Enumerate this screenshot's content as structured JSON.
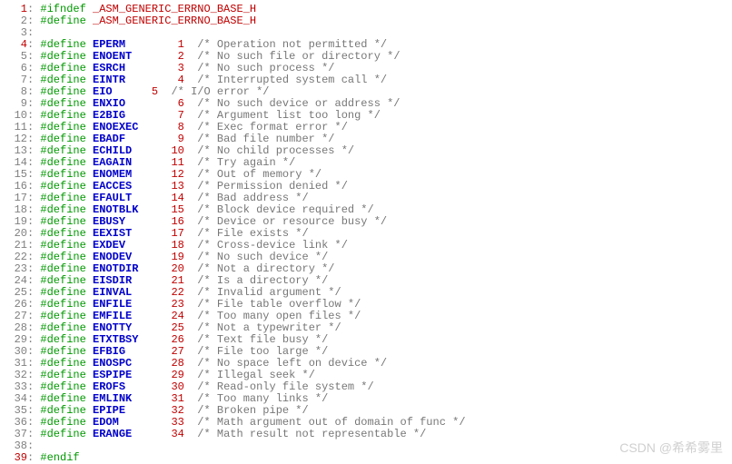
{
  "header_guard": "_ASM_GENERIC_ERRNO_BASE_H",
  "watermark": "CSDN @希希雾里",
  "lines": [
    {
      "n": 1,
      "sel": true,
      "html": "<span class='dir'>#ifndef</span> <span class='headname'>_ASM_GENERIC_ERRNO_BASE_H</span>"
    },
    {
      "n": 2,
      "sel": false,
      "html": "<span class='dir'>#define</span> <span class='headname'>_ASM_GENERIC_ERRNO_BASE_H</span>"
    },
    {
      "n": 3,
      "sel": false,
      "html": ""
    },
    {
      "n": 4,
      "sel": true,
      "html": "<span class='dir'>#define</span> <span class='macro'>EPERM</span>        <span class='num'>1</span>  <span class='cmt'>/* Operation not permitted */</span>"
    },
    {
      "n": 5,
      "sel": false,
      "html": "<span class='dir'>#define</span> <span class='macro'>ENOENT</span>       <span class='num'>2</span>  <span class='cmt'>/* No such file or directory */</span>"
    },
    {
      "n": 6,
      "sel": false,
      "html": "<span class='dir'>#define</span> <span class='macro'>ESRCH</span>        <span class='num'>3</span>  <span class='cmt'>/* No such process */</span>"
    },
    {
      "n": 7,
      "sel": false,
      "html": "<span class='dir'>#define</span> <span class='macro'>EINTR</span>        <span class='num'>4</span>  <span class='cmt'>/* Interrupted system call */</span>"
    },
    {
      "n": 8,
      "sel": false,
      "html": "<span class='dir'>#define</span> <span class='macro'>EIO</span>      <span class='num'>5</span>  <span class='cmt'>/* I/O error */</span>"
    },
    {
      "n": 9,
      "sel": false,
      "html": "<span class='dir'>#define</span> <span class='macro'>ENXIO</span>        <span class='num'>6</span>  <span class='cmt'>/* No such device or address */</span>"
    },
    {
      "n": 10,
      "sel": false,
      "html": "<span class='dir'>#define</span> <span class='macro'>E2BIG</span>        <span class='num'>7</span>  <span class='cmt'>/* Argument list too long */</span>"
    },
    {
      "n": 11,
      "sel": false,
      "html": "<span class='dir'>#define</span> <span class='macro'>ENOEXEC</span>      <span class='num'>8</span>  <span class='cmt'>/* Exec format error */</span>"
    },
    {
      "n": 12,
      "sel": false,
      "html": "<span class='dir'>#define</span> <span class='macro'>EBADF</span>        <span class='num'>9</span>  <span class='cmt'>/* Bad file number */</span>"
    },
    {
      "n": 13,
      "sel": false,
      "html": "<span class='dir'>#define</span> <span class='macro'>ECHILD</span>      <span class='num'>10</span>  <span class='cmt'>/* No child processes */</span>"
    },
    {
      "n": 14,
      "sel": false,
      "html": "<span class='dir'>#define</span> <span class='macro'>EAGAIN</span>      <span class='num'>11</span>  <span class='cmt'>/* Try again */</span>"
    },
    {
      "n": 15,
      "sel": false,
      "html": "<span class='dir'>#define</span> <span class='macro'>ENOMEM</span>      <span class='num'>12</span>  <span class='cmt'>/* Out of memory */</span>"
    },
    {
      "n": 16,
      "sel": false,
      "html": "<span class='dir'>#define</span> <span class='macro'>EACCES</span>      <span class='num'>13</span>  <span class='cmt'>/* Permission denied */</span>"
    },
    {
      "n": 17,
      "sel": false,
      "html": "<span class='dir'>#define</span> <span class='macro'>EFAULT</span>      <span class='num'>14</span>  <span class='cmt'>/* Bad address */</span>"
    },
    {
      "n": 18,
      "sel": false,
      "html": "<span class='dir'>#define</span> <span class='macro'>ENOTBLK</span>     <span class='num'>15</span>  <span class='cmt'>/* Block device required */</span>"
    },
    {
      "n": 19,
      "sel": false,
      "html": "<span class='dir'>#define</span> <span class='macro'>EBUSY</span>       <span class='num'>16</span>  <span class='cmt'>/* Device or resource busy */</span>"
    },
    {
      "n": 20,
      "sel": false,
      "html": "<span class='dir'>#define</span> <span class='macro'>EEXIST</span>      <span class='num'>17</span>  <span class='cmt'>/* File exists */</span>"
    },
    {
      "n": 21,
      "sel": false,
      "html": "<span class='dir'>#define</span> <span class='macro'>EXDEV</span>       <span class='num'>18</span>  <span class='cmt'>/* Cross-device link */</span>"
    },
    {
      "n": 22,
      "sel": false,
      "html": "<span class='dir'>#define</span> <span class='macro'>ENODEV</span>      <span class='num'>19</span>  <span class='cmt'>/* No such device */</span>"
    },
    {
      "n": 23,
      "sel": false,
      "html": "<span class='dir'>#define</span> <span class='macro'>ENOTDIR</span>     <span class='num'>20</span>  <span class='cmt'>/* Not a directory */</span>"
    },
    {
      "n": 24,
      "sel": false,
      "html": "<span class='dir'>#define</span> <span class='macro'>EISDIR</span>      <span class='num'>21</span>  <span class='cmt'>/* Is a directory */</span>"
    },
    {
      "n": 25,
      "sel": false,
      "html": "<span class='dir'>#define</span> <span class='macro'>EINVAL</span>      <span class='num'>22</span>  <span class='cmt'>/* Invalid argument */</span>"
    },
    {
      "n": 26,
      "sel": false,
      "html": "<span class='dir'>#define</span> <span class='macro'>ENFILE</span>      <span class='num'>23</span>  <span class='cmt'>/* File table overflow */</span>"
    },
    {
      "n": 27,
      "sel": false,
      "html": "<span class='dir'>#define</span> <span class='macro'>EMFILE</span>      <span class='num'>24</span>  <span class='cmt'>/* Too many open files */</span>"
    },
    {
      "n": 28,
      "sel": false,
      "html": "<span class='dir'>#define</span> <span class='macro'>ENOTTY</span>      <span class='num'>25</span>  <span class='cmt'>/* Not a typewriter */</span>"
    },
    {
      "n": 29,
      "sel": false,
      "html": "<span class='dir'>#define</span> <span class='macro'>ETXTBSY</span>     <span class='num'>26</span>  <span class='cmt'>/* Text file busy */</span>"
    },
    {
      "n": 30,
      "sel": false,
      "html": "<span class='dir'>#define</span> <span class='macro'>EFBIG</span>       <span class='num'>27</span>  <span class='cmt'>/* File too large */</span>"
    },
    {
      "n": 31,
      "sel": false,
      "html": "<span class='dir'>#define</span> <span class='macro'>ENOSPC</span>      <span class='num'>28</span>  <span class='cmt'>/* No space left on device */</span>"
    },
    {
      "n": 32,
      "sel": false,
      "html": "<span class='dir'>#define</span> <span class='macro'>ESPIPE</span>      <span class='num'>29</span>  <span class='cmt'>/* Illegal seek */</span>"
    },
    {
      "n": 33,
      "sel": false,
      "html": "<span class='dir'>#define</span> <span class='macro'>EROFS</span>       <span class='num'>30</span>  <span class='cmt'>/* Read-only file system */</span>"
    },
    {
      "n": 34,
      "sel": false,
      "html": "<span class='dir'>#define</span> <span class='macro'>EMLINK</span>      <span class='num'>31</span>  <span class='cmt'>/* Too many links */</span>"
    },
    {
      "n": 35,
      "sel": false,
      "html": "<span class='dir'>#define</span> <span class='macro'>EPIPE</span>       <span class='num'>32</span>  <span class='cmt'>/* Broken pipe */</span>"
    },
    {
      "n": 36,
      "sel": false,
      "html": "<span class='dir'>#define</span> <span class='macro'>EDOM</span>        <span class='num'>33</span>  <span class='cmt'>/* Math argument out of domain of func */</span>"
    },
    {
      "n": 37,
      "sel": false,
      "html": "<span class='dir'>#define</span> <span class='macro'>ERANGE</span>      <span class='num'>34</span>  <span class='cmt'>/* Math result not representable */</span>"
    },
    {
      "n": 38,
      "sel": false,
      "html": ""
    },
    {
      "n": 39,
      "sel": true,
      "html": "<span class='dir'>#endif</span>"
    }
  ]
}
